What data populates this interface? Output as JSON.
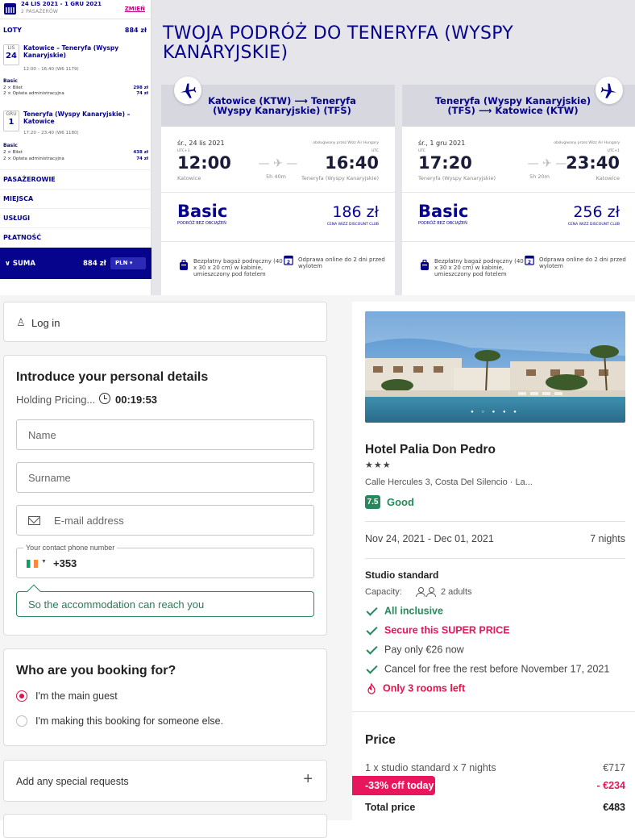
{
  "wizz": {
    "trip_dates": "24 LIS 2021 - 1 GRU 2021",
    "passengers": "2 PASAŻERÓW",
    "change": "ZMIEŃ",
    "flights_label": "LOTY",
    "flights_total": "884 zł",
    "outbound": {
      "month": "LIS",
      "day": "24",
      "route": "Katowice – Teneryfa (Wyspy Kanaryjskie)",
      "time": "12:00 – 16:40 (W6 1179)",
      "fare": "Basic",
      "lines": [
        {
          "label": "2 × Bilet",
          "amount": "298 zł"
        },
        {
          "label": "2 × Opłata administracyjna",
          "amount": "74 zł"
        }
      ]
    },
    "inbound": {
      "month": "GRU",
      "day": "1",
      "route": "Teneryfa (Wyspy Kanaryjskie) – Katowice",
      "time": "17:20 – 23:40 (W6 1180)",
      "fare": "Basic",
      "lines": [
        {
          "label": "2 × Bilet",
          "amount": "438 zł"
        },
        {
          "label": "2 × Opłata administracyjna",
          "amount": "74 zł"
        }
      ]
    },
    "sections": [
      "PASAŻEROWIE",
      "MIEJSCA",
      "USŁUGI",
      "PŁATNOŚĆ"
    ],
    "sum_label": "SUMA",
    "sum_value": "884 zł",
    "currency": "PLN",
    "page_title": "TWOJA PODRÓŻ DO TENERYFA (WYSPY KANARYJSKIE)",
    "cards": [
      {
        "route": "Katowice (KTW) ⟶ Teneryfa (Wyspy Kanaryjskie) (TFS)",
        "date": "śr., 24 lis 2021",
        "operator": "obsługiwany przez Wizz Air Hungary",
        "dep_tz": "UTC+1",
        "arr_tz": "UTC",
        "dep_time": "12:00",
        "arr_time": "16:40",
        "dep_city": "Katowice",
        "arr_city": "Teneryfa (Wyspy Kanaryjskie)",
        "duration": "5h 40m",
        "fare": "Basic",
        "fare_sub": "PODRÓŻ BEZ OBCIĄŻEŃ",
        "price": "186 zł",
        "price_sub": "CENA WIZZ DISCOUNT CLUB",
        "perk1": "Bezpłatny bagaż podręczny (40 x 30 x 20 cm) w kabinie, umieszczony pod fotelem",
        "perk2": "Odprawa online do 2 dni przed wylotem"
      },
      {
        "route": "Teneryfa (Wyspy Kanaryjskie) (TFS) ⟶ Katowice (KTW)",
        "date": "śr., 1 gru 2021",
        "operator": "obsługiwany przez Wizz Air Hungary",
        "dep_tz": "UTC",
        "arr_tz": "UTC+1",
        "dep_time": "17:20",
        "arr_time": "23:40",
        "dep_city": "Teneryfa (Wyspy Kanaryjskie)",
        "arr_city": "Katowice",
        "duration": "5h 20m",
        "fare": "Basic",
        "fare_sub": "PODRÓŻ BEZ OBCIĄŻEŃ",
        "price": "256 zł",
        "price_sub": "CENA WIZZ DISCOUNT CLUB",
        "perk1": "Bezpłatny bagaż podręczny (40 x 30 x 20 cm) w kabinie, umieszczony pod fotelem",
        "perk2": "Odprawa online do 2 dni przed wylotem"
      }
    ],
    "colors": {
      "brand": "#06038d",
      "accent": "#c6007e"
    }
  },
  "booking": {
    "login": "Log in",
    "personal_title": "Introduce your personal details",
    "holding": "Holding Pricing...",
    "timer": "00:19:53",
    "name_placeholder": "Name",
    "surname_placeholder": "Surname",
    "email_placeholder": "E-mail address",
    "phone_label": "Your contact phone number",
    "phone_code": "+353",
    "phone_note": "So the accommodation can reach you",
    "who_title": "Who are you booking for?",
    "option_main": "I'm the main guest",
    "option_other": "I'm making this booking for someone else.",
    "special_requests": "Add any special requests",
    "plus": "+"
  },
  "hotel": {
    "name": "Hotel Palia Don Pedro",
    "stars": "★★★",
    "address": "Calle Hercules 3, Costa Del Silencio · La...",
    "score": "7.5",
    "rating_word": "Good",
    "dates": "Nov 24, 2021 - Dec 01, 2021",
    "nights": "7 nights",
    "room": "Studio standard",
    "capacity_label": "Capacity:",
    "capacity": "2 adults",
    "features": [
      {
        "text": "All inclusive",
        "style": "green-bold"
      },
      {
        "text": "Secure this SUPER PRICE",
        "style": "pink-bold"
      },
      {
        "text": "Pay only €26 now",
        "style": "plain"
      },
      {
        "text": "Cancel for free the rest before November 17, 2021",
        "style": "plain"
      }
    ],
    "scarcity": "Only 3 rooms left",
    "price_title": "Price",
    "price_line": "1 x studio standard x 7 nights",
    "price_line_amount": "€717",
    "discount": "-33% off today",
    "discount_amount": "- €234",
    "total_label": "Total price",
    "total_amount": "€483",
    "colors": {
      "green": "#27895b",
      "pink": "#e8175d"
    }
  }
}
